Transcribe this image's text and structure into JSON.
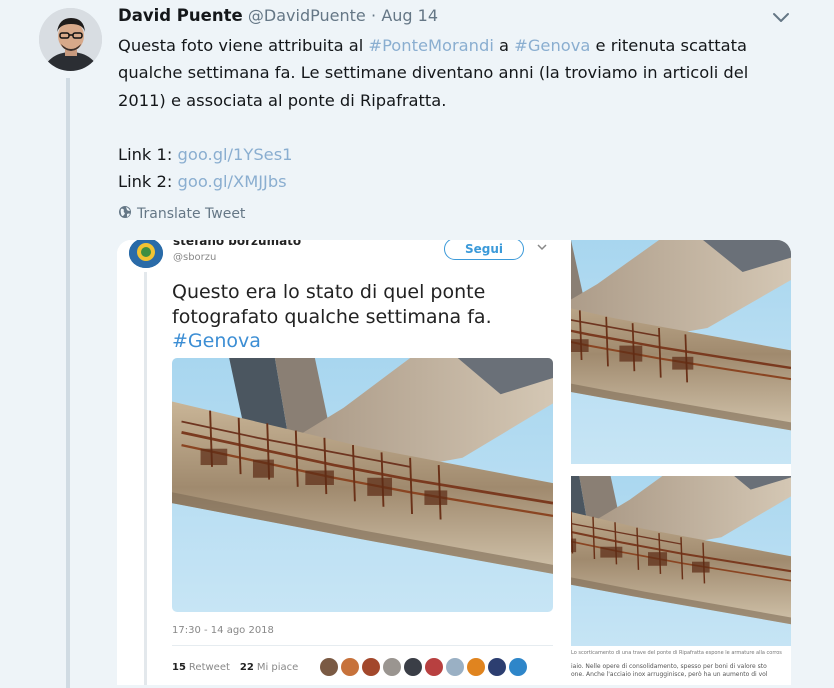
{
  "tweet": {
    "author_name": "David Puente",
    "author_handle": "@DavidPuente",
    "separator": "·",
    "date": "Aug 14",
    "text": {
      "p1_a": "Questa foto viene attribuita al ",
      "hashtag_1": "#PonteMorandi",
      "p1_b": " a ",
      "hashtag_2": "#Genova",
      "p1_c": " e ritenuta scattata qualche settimana fa. Le settimane diventano anni (la troviamo in articoli del 2011) e associata al ponte di Ripafratta.",
      "link1_label": "Link 1: ",
      "link1_url": "goo.gl/1YSes1",
      "link2_label": "Link 2: ",
      "link2_url": "goo.gl/XMJJbs"
    },
    "translate_label": "Translate Tweet",
    "icons": {
      "menu": "chevron-down-icon",
      "translate": "globe-icon"
    }
  },
  "embedded_tweet": {
    "author_name": "stefano borzumato",
    "author_handle": "@sborzu",
    "follow_label": "Segui",
    "text_line1": "Questo era lo stato di quel ponte",
    "text_line2": "fotografato qualche settimana fa.",
    "hashtag": "#Genova",
    "timestamp": "17:30 - 14 ago 2018",
    "retweets_count": "15",
    "retweets_label": "Retweet",
    "likes_count": "22",
    "likes_label": "Mi piace",
    "liker_colors": [
      "#7a5a44",
      "#c7723b",
      "#a3482c",
      "#9a9590",
      "#3a3e46",
      "#b84040",
      "#9ab0c4",
      "#e0841f",
      "#2c3e70",
      "#2e86c9"
    ]
  },
  "side_caption": {
    "line1": "Lo scorticamento di una trave del ponte di Ripafratta espone le armature alla corros",
    "line2": "iaio. Nelle opere di consolidamento, spesso per boni di valore sto",
    "line3": "one. Anche l'acciaio inox arrugginisce, però ha un aumento di vol"
  },
  "colors": {
    "link": "#8aaed0",
    "accent": "#3c9ad9",
    "background": "#eef4f8"
  }
}
